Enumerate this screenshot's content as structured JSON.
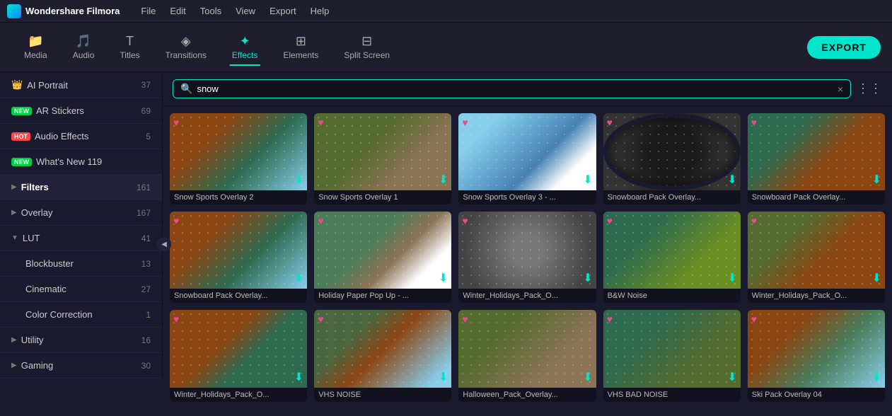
{
  "app": {
    "name": "Wondershare Filmora",
    "logo_text": "Wondershare Filmora"
  },
  "menu": {
    "items": [
      "File",
      "Edit",
      "Tools",
      "View",
      "Export",
      "Help"
    ]
  },
  "toolbar": {
    "items": [
      {
        "id": "media",
        "label": "Media",
        "icon": "☰"
      },
      {
        "id": "audio",
        "label": "Audio",
        "icon": "♪"
      },
      {
        "id": "titles",
        "label": "Titles",
        "icon": "T"
      },
      {
        "id": "transitions",
        "label": "Transitions",
        "icon": "⬡"
      },
      {
        "id": "effects",
        "label": "Effects",
        "icon": "✦"
      },
      {
        "id": "elements",
        "label": "Elements",
        "icon": "⊞"
      },
      {
        "id": "split_screen",
        "label": "Split Screen",
        "icon": "⊟"
      }
    ],
    "active": "effects",
    "export_label": "EXPORT"
  },
  "sidebar": {
    "items": [
      {
        "id": "ai_portrait",
        "label": "AI Portrait",
        "count": "37",
        "badge": "gold"
      },
      {
        "id": "ar_stickers",
        "label": "AR Stickers",
        "count": "69",
        "badge": "new"
      },
      {
        "id": "audio_effects",
        "label": "Audio Effects",
        "count": "5",
        "badge": "hot"
      },
      {
        "id": "whats_new",
        "label": "What's New 119",
        "count": "",
        "badge": "new"
      },
      {
        "id": "filters",
        "label": "Filters",
        "count": "161",
        "badge": "",
        "active": true,
        "expanded": true
      },
      {
        "id": "overlay",
        "label": "Overlay",
        "count": "167",
        "badge": ""
      },
      {
        "id": "lut",
        "label": "LUT",
        "count": "41",
        "badge": "",
        "expandable": true,
        "expanded": true
      }
    ],
    "sub_items": [
      {
        "id": "blockbuster",
        "label": "Blockbuster",
        "count": "13"
      },
      {
        "id": "cinematic",
        "label": "Cinematic",
        "count": "27"
      },
      {
        "id": "color_correction",
        "label": "Color Correction",
        "count": "1"
      }
    ],
    "bottom_items": [
      {
        "id": "utility",
        "label": "Utility",
        "count": "16"
      },
      {
        "id": "gaming",
        "label": "Gaming",
        "count": "30"
      }
    ]
  },
  "search": {
    "placeholder": "Search",
    "value": "snow",
    "clear_icon": "×",
    "grid_icon": "⋮⋮⋮"
  },
  "grid": {
    "cards": [
      {
        "id": 1,
        "label": "Snow Sports Overlay 2",
        "thumb": "thumb-1"
      },
      {
        "id": 2,
        "label": "Snow Sports Overlay 1",
        "thumb": "thumb-2"
      },
      {
        "id": 3,
        "label": "Snow Sports Overlay 3 - ...",
        "thumb": "thumb-3"
      },
      {
        "id": 4,
        "label": "Snowboard Pack Overlay...",
        "thumb": "thumb-4"
      },
      {
        "id": 5,
        "label": "Snowboard Pack Overlay...",
        "thumb": "thumb-5"
      },
      {
        "id": 6,
        "label": "Snowboard Pack Overlay...",
        "thumb": "thumb-6"
      },
      {
        "id": 7,
        "label": "Holiday Paper Pop Up - ...",
        "thumb": "thumb-7"
      },
      {
        "id": 8,
        "label": "Winter_Holidays_Pack_O...",
        "thumb": "thumb-8"
      },
      {
        "id": 9,
        "label": "B&W Noise",
        "thumb": "thumb-9"
      },
      {
        "id": 10,
        "label": "Winter_Holidays_Pack_O...",
        "thumb": "thumb-10"
      },
      {
        "id": 11,
        "label": "Winter_Holidays_Pack_O...",
        "thumb": "thumb-11"
      },
      {
        "id": 12,
        "label": "VHS NOISE",
        "thumb": "thumb-12"
      },
      {
        "id": 13,
        "label": "Halloween_Pack_Overlay...",
        "thumb": "thumb-13"
      },
      {
        "id": 14,
        "label": "VHS BAD NOISE",
        "thumb": "thumb-14"
      },
      {
        "id": 15,
        "label": "Ski Pack Overlay 04",
        "thumb": "thumb-15"
      }
    ]
  }
}
